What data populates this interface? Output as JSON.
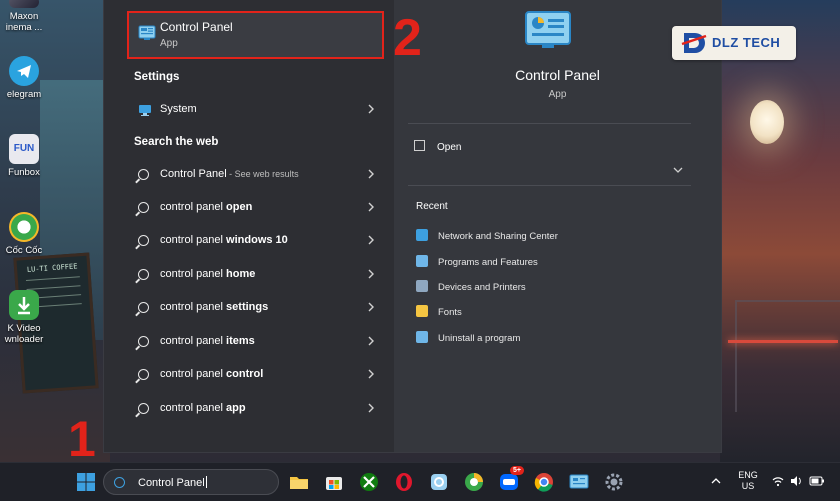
{
  "desktop": {
    "icons": [
      {
        "label_line1": "Maxon",
        "label_line2": "inema ..."
      },
      {
        "label_line1": "elegram",
        "label_line2": ""
      },
      {
        "label_line1": "Funbox",
        "label_line2": ""
      },
      {
        "label_line1": "Cốc Cốc",
        "label_line2": ""
      },
      {
        "label_line1": "K Video",
        "label_line2": "wnloader"
      }
    ],
    "board_text": "LU-TI COFFEE"
  },
  "search_panel": {
    "best_match": {
      "title": "Control Panel",
      "subtitle": "App"
    },
    "settings_header": "Settings",
    "settings_items": [
      {
        "label": "System"
      }
    ],
    "web_header": "Search the web",
    "web_items": [
      {
        "prefix": "Control Panel",
        "bold": "",
        "suffix": " - See web results"
      },
      {
        "prefix": "control panel ",
        "bold": "open",
        "suffix": ""
      },
      {
        "prefix": "control panel ",
        "bold": "windows 10",
        "suffix": ""
      },
      {
        "prefix": "control panel ",
        "bold": "home",
        "suffix": ""
      },
      {
        "prefix": "control panel ",
        "bold": "settings",
        "suffix": ""
      },
      {
        "prefix": "control panel ",
        "bold": "items",
        "suffix": ""
      },
      {
        "prefix": "control panel ",
        "bold": "control",
        "suffix": ""
      },
      {
        "prefix": "control panel ",
        "bold": "app",
        "suffix": ""
      }
    ]
  },
  "detail_pane": {
    "title": "Control Panel",
    "subtitle": "App",
    "open_label": "Open",
    "recent_header": "Recent",
    "recent_items": [
      "Network and Sharing Center",
      "Programs and Features",
      "Devices and Printers",
      "Fonts",
      "Uninstall a program"
    ]
  },
  "annotations": {
    "step1": "1",
    "step2": "2"
  },
  "brand": {
    "text": "DLZ TECH"
  },
  "taskbar": {
    "search_value": "Control Panel",
    "zalo_badge": "5+",
    "lang_line1": "ENG",
    "lang_line2": "US"
  },
  "colors": {
    "annotation_red": "#e2231a",
    "accent_blue": "#3da0e0",
    "panel_bg": "#2d2e33"
  }
}
